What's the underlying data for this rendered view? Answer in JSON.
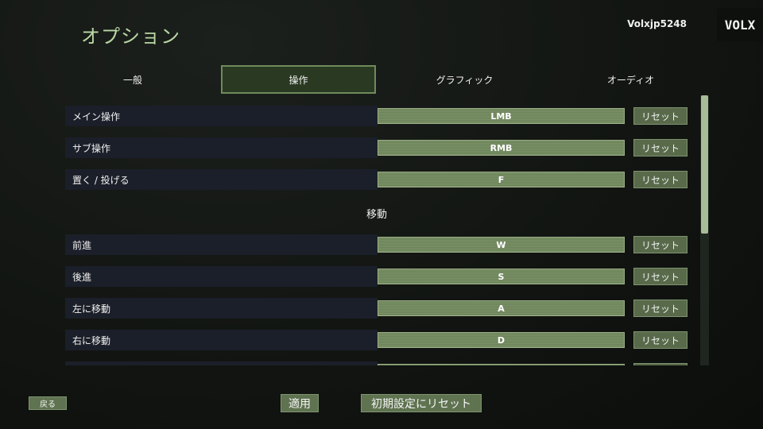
{
  "header": {
    "title": "オプション",
    "username": "Volxjp5248",
    "logo_text": "VOLX"
  },
  "tabs": [
    {
      "label": "一般",
      "active": false
    },
    {
      "label": "操作",
      "active": true
    },
    {
      "label": "グラフィック",
      "active": false
    },
    {
      "label": "オーディオ",
      "active": false
    }
  ],
  "bindings_top": [
    {
      "label": "メイン操作",
      "key": "LMB",
      "reset": "リセット"
    },
    {
      "label": "サブ操作",
      "key": "RMB",
      "reset": "リセット"
    },
    {
      "label": "置く / 投げる",
      "key": "F",
      "reset": "リセット"
    }
  ],
  "section_movement": "移動",
  "bindings_movement": [
    {
      "label": "前進",
      "key": "W",
      "reset": "リセット"
    },
    {
      "label": "後進",
      "key": "S",
      "reset": "リセット"
    },
    {
      "label": "左に移動",
      "key": "A",
      "reset": "リセット"
    },
    {
      "label": "右に移動",
      "key": "D",
      "reset": "リセット"
    }
  ],
  "footer": {
    "back_label": "戻る",
    "apply_label": "適用",
    "reset_all_label": "初期設定にリセット"
  },
  "colors": {
    "accent": "#b9d8a4",
    "button": "#5f7350",
    "row_background": "#1b1f29"
  }
}
